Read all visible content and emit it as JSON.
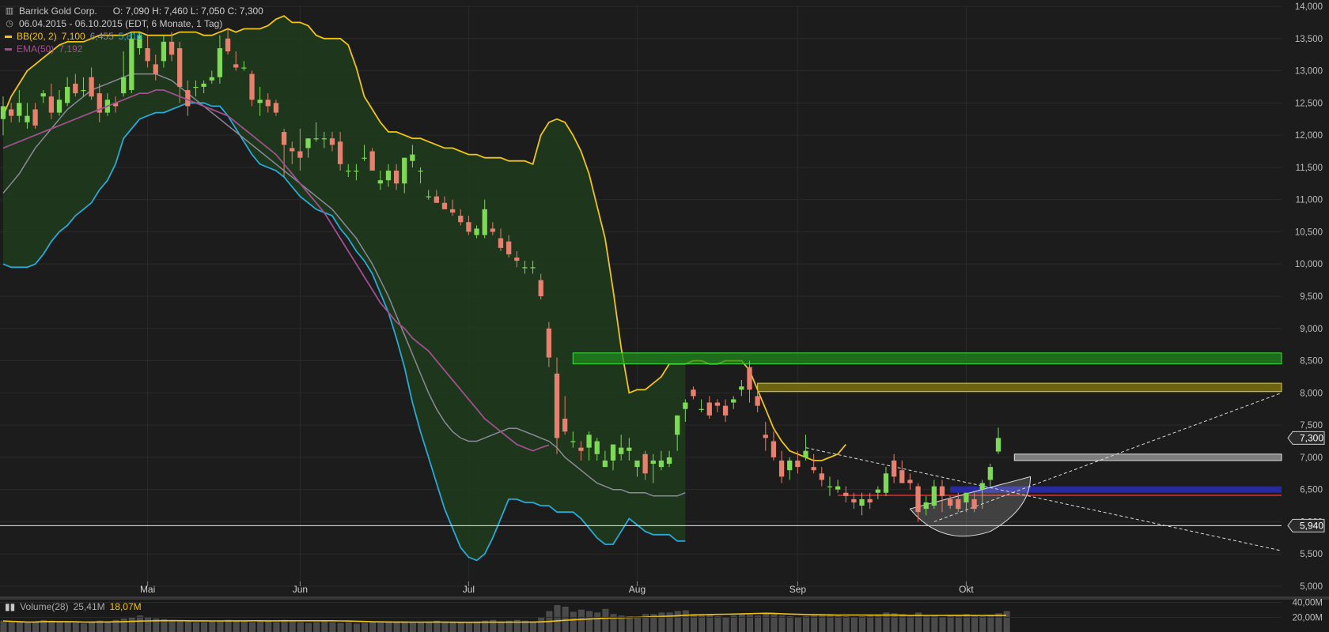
{
  "legend": {
    "title": "Barrick Gold Corp.",
    "ohlc": "O: 7,090  H: 7,460  L: 7,050  C: 7,300",
    "range": "06.04.2015 - 06.10.2015 (EDT, 6 Monate, 1 Tag)",
    "bb_label": "BB(20, 2)",
    "bb_upper": "7,100",
    "bb_mid": "6,455",
    "bb_lower": "5,810",
    "ema_label": "EMA(50)",
    "ema_value": "7,192",
    "volume_label": "Volume(28)",
    "volume_value1": "25,41M",
    "volume_value2": "18,07M"
  },
  "colors": {
    "background": "#1c1c1c",
    "up": "#7ed957",
    "down": "#e8806f",
    "bb_upper": "#f0c419",
    "bb_lower": "#2aa9d6",
    "bb_mid": "#8a8a9a",
    "bb_fill": "#1f3a1c",
    "ema": "#a0508f",
    "grid": "#2a2a2a"
  },
  "chart_data": {
    "type": "candlestick",
    "y_axis": {
      "min": 5000,
      "max": 14000,
      "ticks": [
        "14,000",
        "13,500",
        "13,000",
        "12,500",
        "12,000",
        "11,500",
        "11,000",
        "10,500",
        "10,000",
        "9,500",
        "9,000",
        "8,500",
        "8,000",
        "7,500",
        "7,000",
        "6,500",
        "6,000",
        "5,500",
        "5,000"
      ],
      "tick_values": [
        14000,
        13500,
        13000,
        12500,
        12000,
        11500,
        11000,
        10500,
        10000,
        9500,
        9000,
        8500,
        8000,
        7500,
        7000,
        6500,
        6000,
        5500,
        5000
      ]
    },
    "x_labels": [
      "Mai",
      "Jun",
      "Jul",
      "Aug",
      "Sep",
      "Okt"
    ],
    "x_label_index": [
      18,
      37,
      58,
      79,
      99,
      120
    ],
    "candles": [
      [
        12.25,
        12.6,
        12.0,
        12.45
      ],
      [
        12.4,
        12.5,
        12.2,
        12.3
      ],
      [
        12.3,
        12.7,
        12.2,
        12.5
      ],
      [
        12.2,
        12.5,
        12.1,
        12.3
      ],
      [
        12.4,
        12.5,
        12.1,
        12.15
      ],
      [
        12.6,
        12.7,
        12.5,
        12.65
      ],
      [
        12.6,
        12.8,
        12.25,
        12.35
      ],
      [
        12.35,
        12.7,
        12.3,
        12.55
      ],
      [
        12.5,
        12.9,
        12.45,
        12.75
      ],
      [
        12.8,
        12.95,
        12.6,
        12.65
      ],
      [
        12.7,
        12.9,
        12.6,
        12.7
      ],
      [
        12.9,
        13.05,
        12.55,
        12.6
      ],
      [
        12.65,
        12.8,
        12.2,
        12.35
      ],
      [
        12.35,
        12.65,
        12.3,
        12.55
      ],
      [
        12.5,
        12.6,
        12.35,
        12.45
      ],
      [
        12.65,
        13.3,
        12.6,
        12.9
      ],
      [
        12.7,
        13.6,
        12.65,
        13.5
      ],
      [
        13.35,
        13.6,
        13.25,
        13.55
      ],
      [
        13.35,
        13.55,
        13.05,
        13.15
      ],
      [
        13.1,
        13.25,
        12.85,
        12.95
      ],
      [
        13.15,
        13.55,
        13.05,
        13.45
      ],
      [
        13.45,
        13.6,
        13.15,
        13.25
      ],
      [
        13.35,
        13.45,
        12.5,
        12.75
      ],
      [
        12.7,
        12.85,
        12.3,
        12.45
      ],
      [
        12.75,
        12.85,
        12.6,
        12.75
      ],
      [
        12.75,
        12.85,
        12.65,
        12.8
      ],
      [
        12.85,
        13.0,
        12.8,
        12.9
      ],
      [
        12.9,
        13.55,
        12.8,
        13.35
      ],
      [
        13.5,
        13.65,
        13.25,
        13.3
      ],
      [
        13.1,
        13.3,
        13.0,
        13.05
      ],
      [
        13.05,
        13.15,
        13.0,
        13.05
      ],
      [
        12.95,
        13.0,
        12.45,
        12.55
      ],
      [
        12.5,
        12.75,
        12.3,
        12.55
      ],
      [
        12.55,
        12.65,
        12.35,
        12.45
      ],
      [
        12.5,
        12.55,
        12.3,
        12.35
      ],
      [
        12.05,
        12.1,
        11.35,
        11.85
      ],
      [
        11.8,
        11.9,
        11.55,
        11.75
      ],
      [
        11.75,
        12.1,
        11.45,
        11.65
      ],
      [
        11.8,
        11.95,
        11.65,
        11.95
      ],
      [
        11.95,
        12.2,
        11.9,
        11.95
      ],
      [
        11.95,
        12.05,
        11.8,
        11.95
      ],
      [
        11.95,
        12.05,
        11.75,
        11.85
      ],
      [
        11.9,
        12.05,
        11.45,
        11.55
      ],
      [
        11.45,
        11.55,
        11.35,
        11.45
      ],
      [
        11.45,
        11.55,
        11.3,
        11.45
      ],
      [
        11.65,
        11.85,
        11.6,
        11.65
      ],
      [
        11.75,
        11.8,
        11.45,
        11.45
      ],
      [
        11.25,
        11.45,
        11.15,
        11.3
      ],
      [
        11.3,
        11.55,
        11.2,
        11.45
      ],
      [
        11.45,
        11.55,
        11.15,
        11.25
      ],
      [
        11.25,
        11.6,
        11.1,
        11.65
      ],
      [
        11.6,
        11.85,
        11.5,
        11.7
      ],
      [
        11.45,
        11.5,
        11.25,
        11.45
      ],
      [
        11.05,
        11.15,
        11.0,
        11.05
      ],
      [
        11.05,
        11.15,
        10.95,
        10.95
      ],
      [
        10.95,
        11.05,
        10.85,
        10.85
      ],
      [
        10.85,
        11.0,
        10.75,
        10.8
      ],
      [
        10.75,
        10.85,
        10.6,
        10.65
      ],
      [
        10.65,
        10.75,
        10.45,
        10.5
      ],
      [
        10.45,
        10.6,
        10.4,
        10.55
      ],
      [
        10.45,
        11.0,
        10.4,
        10.85
      ],
      [
        10.55,
        10.65,
        10.45,
        10.5
      ],
      [
        10.4,
        10.55,
        10.2,
        10.25
      ],
      [
        10.35,
        10.45,
        10.1,
        10.15
      ],
      [
        10.1,
        10.2,
        9.95,
        10.05
      ],
      [
        9.95,
        10.05,
        9.85,
        9.95
      ],
      [
        9.95,
        10.05,
        9.85,
        9.95
      ],
      [
        9.75,
        9.85,
        9.45,
        9.5
      ],
      [
        9.0,
        9.1,
        8.4,
        8.55
      ],
      [
        8.3,
        8.55,
        7.05,
        7.3
      ],
      [
        7.6,
        7.95,
        7.35,
        7.4
      ],
      [
        7.25,
        7.4,
        7.15,
        7.25
      ],
      [
        7.15,
        7.25,
        6.95,
        7.1
      ],
      [
        7.15,
        7.4,
        6.95,
        7.35
      ],
      [
        7.05,
        7.3,
        6.95,
        7.25
      ],
      [
        6.85,
        7.1,
        6.85,
        6.95
      ],
      [
        6.95,
        7.2,
        6.8,
        7.2
      ],
      [
        7.05,
        7.35,
        6.95,
        7.15
      ],
      [
        7.1,
        7.3,
        6.95,
        7.15
      ],
      [
        6.85,
        6.95,
        6.7,
        6.95
      ],
      [
        7.05,
        7.1,
        6.65,
        6.75
      ],
      [
        6.9,
        7.05,
        6.6,
        6.95
      ],
      [
        6.85,
        7.1,
        6.8,
        6.95
      ],
      [
        6.9,
        7.1,
        6.85,
        7.0
      ],
      [
        7.35,
        7.65,
        7.1,
        7.65
      ],
      [
        7.75,
        7.9,
        7.55,
        7.85
      ],
      [
        8.05,
        8.1,
        7.9,
        7.95
      ],
      [
        7.75,
        7.9,
        7.7,
        7.75
      ],
      [
        7.85,
        7.95,
        7.6,
        7.65
      ],
      [
        7.85,
        7.9,
        7.7,
        7.8
      ],
      [
        7.8,
        7.9,
        7.55,
        7.65
      ],
      [
        7.85,
        7.95,
        7.75,
        7.9
      ],
      [
        8.05,
        8.2,
        7.95,
        8.1
      ],
      [
        8.4,
        8.5,
        7.85,
        8.05
      ],
      [
        7.95,
        8.05,
        7.7,
        7.8
      ],
      [
        7.35,
        7.55,
        7.1,
        7.3
      ],
      [
        7.25,
        7.4,
        6.95,
        7.0
      ],
      [
        6.95,
        7.1,
        6.6,
        6.7
      ],
      [
        6.8,
        7.0,
        6.65,
        6.95
      ],
      [
        6.95,
        7.1,
        6.75,
        6.85
      ],
      [
        7.0,
        7.35,
        6.95,
        7.1
      ],
      [
        6.85,
        7.05,
        6.75,
        6.8
      ],
      [
        6.75,
        6.85,
        6.55,
        6.65
      ],
      [
        6.55,
        6.7,
        6.4,
        6.55
      ],
      [
        6.5,
        6.65,
        6.45,
        6.55
      ],
      [
        6.45,
        6.55,
        6.3,
        6.4
      ],
      [
        6.35,
        6.45,
        6.2,
        6.3
      ],
      [
        6.25,
        6.45,
        6.1,
        6.35
      ],
      [
        6.35,
        6.45,
        6.2,
        6.3
      ],
      [
        6.45,
        6.55,
        6.35,
        6.5
      ],
      [
        6.45,
        6.85,
        6.4,
        6.75
      ],
      [
        6.95,
        7.05,
        6.6,
        6.7
      ],
      [
        6.8,
        6.95,
        6.6,
        6.6
      ],
      [
        6.65,
        6.75,
        6.5,
        6.6
      ],
      [
        6.55,
        6.6,
        6.0,
        6.15
      ],
      [
        6.2,
        6.4,
        6.1,
        6.3
      ],
      [
        6.25,
        6.65,
        6.2,
        6.55
      ],
      [
        6.55,
        6.65,
        6.15,
        6.4
      ],
      [
        6.35,
        6.4,
        6.2,
        6.25
      ],
      [
        6.35,
        6.45,
        6.15,
        6.2
      ],
      [
        6.3,
        6.45,
        6.15,
        6.45
      ],
      [
        6.35,
        6.45,
        6.15,
        6.2
      ],
      [
        6.5,
        6.65,
        6.2,
        6.6
      ],
      [
        6.65,
        6.9,
        6.55,
        6.85
      ],
      [
        7.09,
        7.46,
        7.05,
        7.3
      ]
    ],
    "bb_upper": [
      12.3,
      12.6,
      12.8,
      13.0,
      13.1,
      13.2,
      13.3,
      13.4,
      13.45,
      13.45,
      13.45,
      13.5,
      13.55,
      13.55,
      13.55,
      13.55,
      13.6,
      13.6,
      13.55,
      13.55,
      13.55,
      13.55,
      13.6,
      13.6,
      13.6,
      13.55,
      13.55,
      13.6,
      13.65,
      13.6,
      13.65,
      13.65,
      13.65,
      13.7,
      13.8,
      13.85,
      13.75,
      13.75,
      13.7,
      13.55,
      13.5,
      13.5,
      13.5,
      13.4,
      13.05,
      12.6,
      12.4,
      12.2,
      12.05,
      12.05,
      12.0,
      11.95,
      11.95,
      11.9,
      11.85,
      11.8,
      11.8,
      11.75,
      11.7,
      11.7,
      11.65,
      11.65,
      11.65,
      11.6,
      11.6,
      11.6,
      11.55,
      12.0,
      12.2,
      12.25,
      12.2,
      12.0,
      11.75,
      11.4,
      10.9,
      10.4,
      9.6,
      8.7,
      8.0,
      8.05,
      8.05,
      8.15,
      8.25,
      8.45,
      8.45,
      8.45,
      8.5,
      8.5,
      8.45,
      8.45,
      8.5,
      8.5,
      8.5,
      8.35,
      8.05,
      7.75,
      7.45,
      7.25,
      7.1,
      7.05,
      7.0,
      6.95,
      6.95,
      7.0,
      7.05,
      7.2
    ],
    "bb_mid": [
      11.1,
      11.25,
      11.4,
      11.6,
      11.8,
      11.95,
      12.1,
      12.25,
      12.4,
      12.5,
      12.6,
      12.7,
      12.75,
      12.8,
      12.85,
      12.9,
      12.95,
      12.95,
      12.95,
      12.95,
      12.9,
      12.85,
      12.75,
      12.65,
      12.55,
      12.45,
      12.35,
      12.25,
      12.15,
      12.05,
      11.95,
      11.85,
      11.75,
      11.65,
      11.55,
      11.45,
      11.35,
      11.25,
      11.15,
      11.05,
      10.95,
      10.85,
      10.7,
      10.55,
      10.4,
      10.2,
      10.0,
      9.75,
      9.5,
      9.2,
      8.9,
      8.6,
      8.3,
      8.0,
      7.75,
      7.55,
      7.4,
      7.3,
      7.25,
      7.25,
      7.3,
      7.35,
      7.4,
      7.45,
      7.45,
      7.4,
      7.35,
      7.3,
      7.25,
      7.15,
      7.0,
      6.9,
      6.8,
      6.7,
      6.6,
      6.55,
      6.5,
      6.5,
      6.45,
      6.45,
      6.45,
      6.4,
      6.4,
      6.4,
      6.4,
      6.45
    ],
    "bb_lower": [
      10.0,
      9.95,
      9.95,
      9.95,
      10.0,
      10.15,
      10.35,
      10.5,
      10.6,
      10.75,
      10.85,
      10.95,
      11.15,
      11.3,
      11.55,
      11.95,
      12.1,
      12.25,
      12.3,
      12.35,
      12.35,
      12.4,
      12.45,
      12.5,
      12.5,
      12.5,
      12.45,
      12.45,
      12.3,
      12.1,
      11.9,
      11.7,
      11.55,
      11.5,
      11.45,
      11.35,
      11.2,
      11.05,
      10.95,
      10.85,
      10.8,
      10.75,
      10.55,
      10.4,
      10.2,
      10.05,
      9.85,
      9.55,
      9.25,
      8.85,
      8.4,
      7.85,
      7.4,
      7.0,
      6.6,
      6.2,
      5.9,
      5.6,
      5.45,
      5.4,
      5.5,
      5.75,
      6.05,
      6.35,
      6.35,
      6.3,
      6.3,
      6.25,
      6.25,
      6.15,
      6.15,
      6.15,
      6.05,
      5.9,
      5.75,
      5.65,
      5.65,
      5.85,
      6.05,
      5.95,
      5.85,
      5.8,
      5.8,
      5.8,
      5.7,
      5.7
    ],
    "ema": [
      11.8,
      11.85,
      11.9,
      11.95,
      12.0,
      12.05,
      12.1,
      12.15,
      12.2,
      12.25,
      12.3,
      12.35,
      12.4,
      12.45,
      12.5,
      12.55,
      12.6,
      12.65,
      12.65,
      12.7,
      12.7,
      12.65,
      12.6,
      12.55,
      12.5,
      12.45,
      12.4,
      12.35,
      12.3,
      12.2,
      12.1,
      12.0,
      11.9,
      11.8,
      11.7,
      11.55,
      11.4,
      11.25,
      11.1,
      10.95,
      10.8,
      10.6,
      10.4,
      10.2,
      10.0,
      9.8,
      9.6,
      9.4,
      9.25,
      9.1,
      9.0,
      8.85,
      8.75,
      8.65,
      8.5,
      8.35,
      8.2,
      8.05,
      7.9,
      7.75,
      7.6,
      7.5,
      7.4,
      7.3,
      7.2,
      7.15,
      7.1,
      7.15,
      7.19
    ],
    "volume": [
      15,
      14,
      13,
      12,
      14,
      16,
      15,
      13,
      14,
      12,
      11,
      13,
      15,
      14,
      16,
      18,
      19,
      22,
      20,
      18,
      17,
      16,
      15,
      14,
      13,
      13,
      14,
      15,
      16,
      15,
      14,
      13,
      14,
      15,
      13,
      16,
      14,
      13,
      12,
      13,
      14,
      13,
      12,
      13,
      11,
      12,
      13,
      12,
      13,
      14,
      13,
      12,
      13,
      14,
      15,
      14,
      13,
      12,
      13,
      14,
      15,
      16,
      14,
      15,
      16,
      15,
      14,
      20,
      28,
      36,
      34,
      27,
      30,
      28,
      26,
      31,
      24,
      22,
      21,
      20,
      24,
      24,
      26,
      26,
      28,
      29,
      24,
      22,
      23,
      21,
      20,
      22,
      24,
      23,
      22,
      26,
      24,
      22,
      21,
      20,
      21,
      22,
      23,
      24,
      22,
      21,
      20,
      21,
      22,
      23,
      26,
      25,
      24,
      22,
      26,
      21,
      22,
      20,
      23,
      22,
      24,
      22,
      21,
      23,
      25,
      28
    ],
    "volume_axis": {
      "ticks": [
        "40,00M",
        "20,00M"
      ],
      "tick_values": [
        40,
        20
      ],
      "max": 45
    },
    "price_tags": [
      {
        "text": "7,300",
        "value": 7.3
      },
      {
        "text": "5,940",
        "value": 5.94
      }
    ]
  }
}
